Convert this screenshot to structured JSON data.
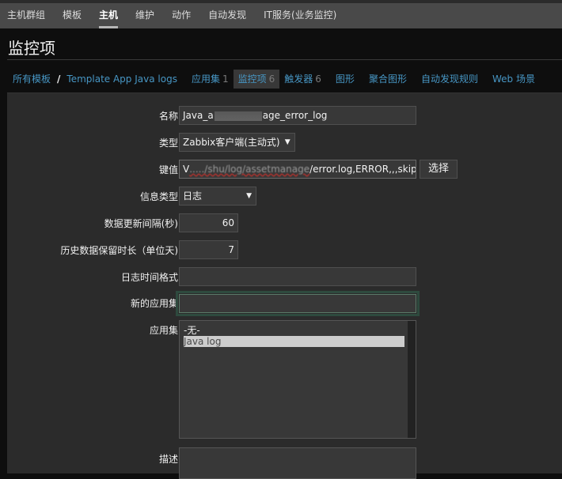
{
  "topnav": {
    "items": [
      {
        "label": "主机群组",
        "active": false
      },
      {
        "label": "模板",
        "active": false
      },
      {
        "label": "主机",
        "active": true
      },
      {
        "label": "维护",
        "active": false
      },
      {
        "label": "动作",
        "active": false
      },
      {
        "label": "自动发现",
        "active": false
      },
      {
        "label": "IT服务(业务监控)",
        "active": false
      }
    ]
  },
  "header": {
    "title": "监控项"
  },
  "breadcrumbs": {
    "all_templates": "所有模板",
    "separator": "/",
    "template": "Template App Java logs",
    "tabs": [
      {
        "label": "应用集",
        "count": "1"
      },
      {
        "label": "监控项",
        "count": "6",
        "active": true
      },
      {
        "label": "触发器",
        "count": "6"
      },
      {
        "label": "图形",
        "count": ""
      },
      {
        "label": "聚合图形",
        "count": ""
      },
      {
        "label": "自动发现规则",
        "count": ""
      },
      {
        "label": "Web 场景",
        "count": ""
      }
    ]
  },
  "form": {
    "name": {
      "label": "名称",
      "value_prefix": "Java_a",
      "value_suffix": "age_error_log"
    },
    "type": {
      "label": "类型",
      "value": "Zabbix客户端(主动式)"
    },
    "key": {
      "label": "键值",
      "value_prefix": "V",
      "value_blurred": "...../shu/log/assetmanage",
      "value_suffix": "/error.log,ERROR,,,skip,]",
      "select_button": "选择"
    },
    "info_type": {
      "label": "信息类型",
      "value": "日志"
    },
    "update_interval": {
      "label": "数据更新间隔(秒)",
      "value": "60"
    },
    "history": {
      "label": "历史数据保留时长（单位天)",
      "value": "7"
    },
    "log_time_format": {
      "label": "日志时间格式",
      "value": ""
    },
    "new_application": {
      "label": "新的应用集",
      "value": ""
    },
    "applications": {
      "label": "应用集",
      "options": [
        "-无-",
        "Java log"
      ],
      "selected": "Java log"
    },
    "description": {
      "label": "描述",
      "value": ""
    }
  },
  "icons": {
    "dropdown_arrow": "▼"
  }
}
